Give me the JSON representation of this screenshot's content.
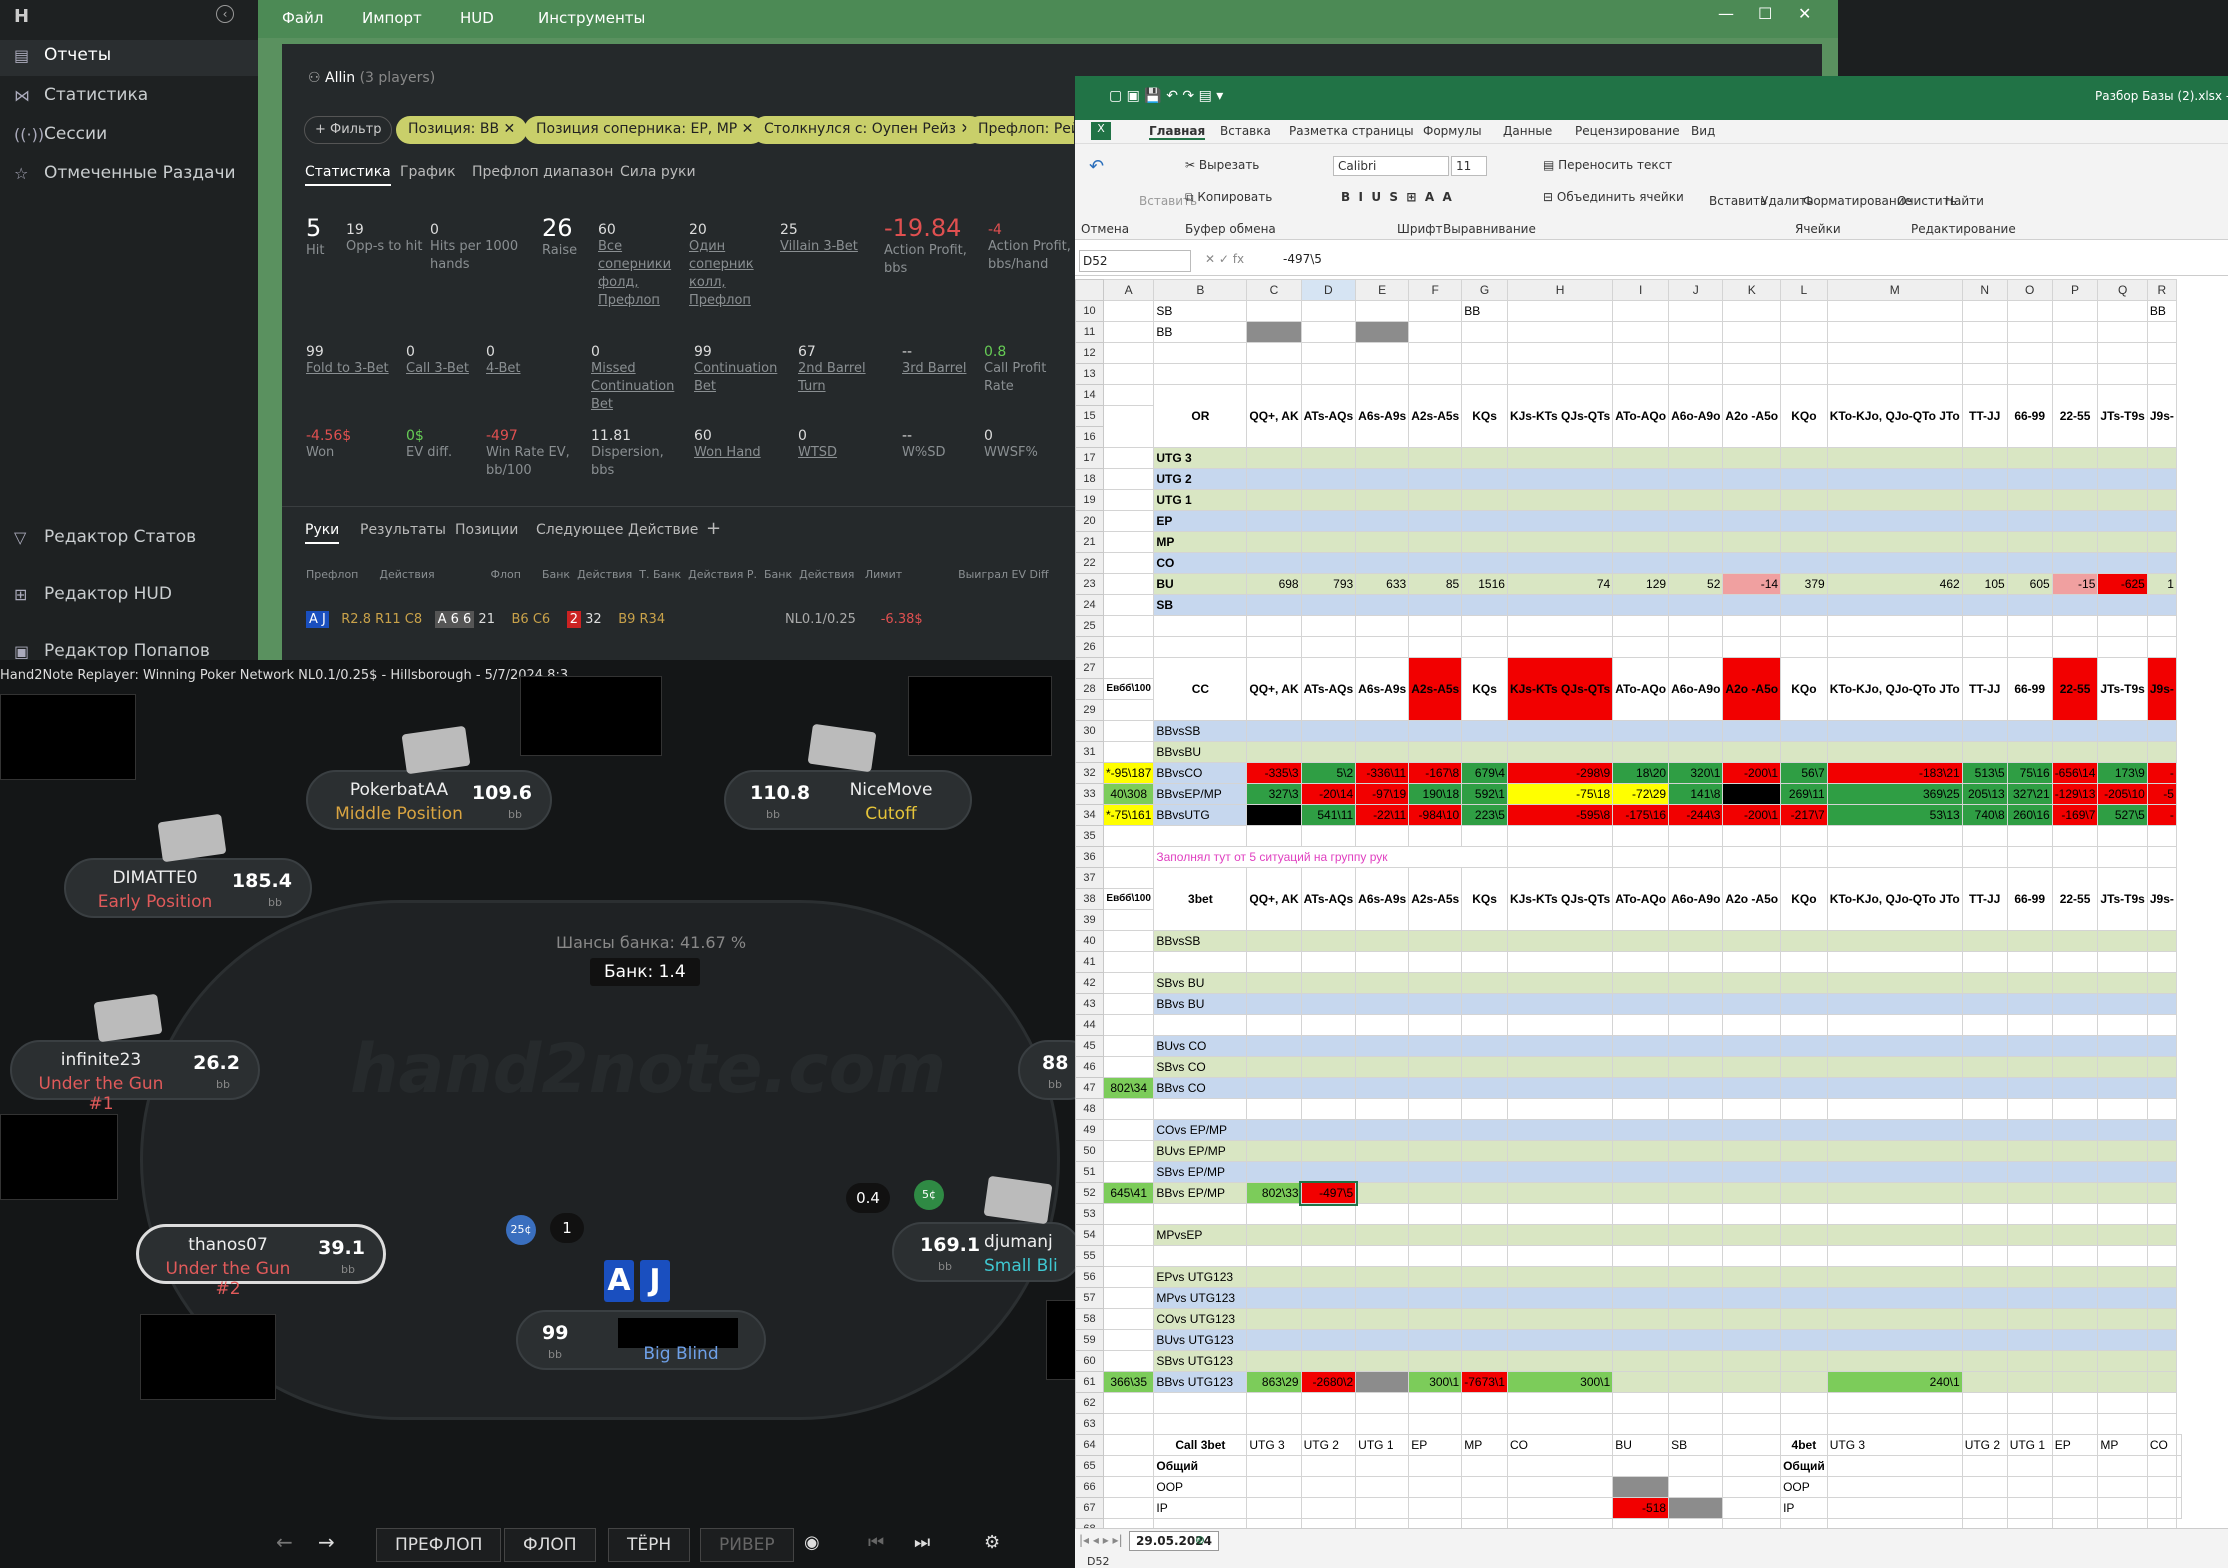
{
  "app": {
    "logo": "H",
    "menu": [
      "Файл",
      "Импорт",
      "HUD",
      "Инструменты"
    ]
  },
  "sidebar": {
    "items": [
      "Отчеты",
      "Статистика",
      "Сессии",
      "Отмеченные Раздачи"
    ],
    "tools": [
      "Редактор Статов",
      "Редактор HUD",
      "Редактор Попапов"
    ]
  },
  "report": {
    "title": "Allin",
    "subtitle": "(3 players)",
    "filter_btn": "+ Фильтр",
    "chips": [
      "Позиция: BB ✕",
      "Позиция соперника: EP, MP ✕",
      "Столкнулся с: Оупен Рейз ✕",
      "Префлоп: Рейз"
    ],
    "tabs": [
      "Статистика",
      "График",
      "Префлоп диапазон",
      "Сила руки"
    ],
    "stats_row1": [
      [
        "5",
        "Hit"
      ],
      [
        "19",
        "Opp-s to hit"
      ],
      [
        "0",
        "Hits per 1000 hands"
      ],
      [
        "26",
        "Raise"
      ],
      [
        "60",
        "Все соперники фолд, Префлоп"
      ],
      [
        "20",
        "Один соперник колл, Префлоп"
      ],
      [
        "25",
        "Villain 3-Bet"
      ],
      [
        "-19.84",
        "Action Profit, bbs"
      ],
      [
        "-4",
        "Action Profit, bbs/hand"
      ]
    ],
    "stats_row2": [
      [
        "99",
        "Fold to 3-Bet"
      ],
      [
        "0",
        "Call 3-Bet"
      ],
      [
        "0",
        "4-Bet"
      ],
      [
        "0",
        "Missed Continuation Bet"
      ],
      [
        "99",
        "Continuation Bet"
      ],
      [
        "67",
        "2nd Barrel Turn"
      ],
      [
        "--",
        "3rd Barrel"
      ],
      [
        "0.8",
        "Call Profit Rate"
      ]
    ],
    "stats_row3": [
      [
        "-4.56$",
        "Won"
      ],
      [
        "0$",
        "EV diff."
      ],
      [
        "-497",
        "Win Rate EV, bb/100"
      ],
      [
        "11.81",
        "Dispersion, bbs"
      ],
      [
        "60",
        "Won Hand"
      ],
      [
        "0",
        "WTSD"
      ],
      [
        "--",
        "W%SD"
      ],
      [
        "0",
        "WWSF%"
      ]
    ],
    "hand_tabs": [
      "Руки",
      "Результаты",
      "Позиции",
      "Следующее Действие",
      "+"
    ],
    "hand_cols": [
      "Префлоп",
      "Действия",
      "Флоп",
      "Банк",
      "Действия",
      "Т.",
      "Банк",
      "Действия",
      "Р.",
      "Банк",
      "Действия",
      "Лимит",
      "Выиграл",
      "EV Diff"
    ],
    "hand_row": {
      "cards": "A J",
      "pre": "R2.8 R11 C8",
      "flop": "A 6 6",
      "pot1": "21",
      "act2": "B6 C6",
      "turn": "2",
      "pot2": "32",
      "act3": "B9 R34",
      "limit": "NL0.1/0.25",
      "won": "-6.38$"
    }
  },
  "replayer": {
    "title": "Hand2Note Replayer: Winning Poker Network NL0.1/0.25$ - Hillsborough - 5/7/2024 8:3",
    "watermark": "hand2note.com",
    "pot_odds": "Шансы банка: 41.67 %",
    "pot": "Банк: 1.4",
    "seats": [
      {
        "name": "PokerbatAA",
        "pos": "Middle Position",
        "stack": "109.6",
        "unit": "bb"
      },
      {
        "name": "NiceMove",
        "pos": "Cutoff",
        "stack": "110.8",
        "unit": "bb"
      },
      {
        "name": "DIMATTE0",
        "pos": "Early Position",
        "stack": "185.4",
        "unit": "bb"
      },
      {
        "name": "infinite23",
        "pos": "Under the Gun #1",
        "stack": "26.2",
        "unit": "bb"
      },
      {
        "name": "thanos07",
        "pos": "Under the Gun #2",
        "stack": "39.1",
        "unit": "bb"
      },
      {
        "name": "djumanj",
        "pos": "Small Bli",
        "stack": "169.1",
        "unit": "bb"
      },
      {
        "name": "",
        "pos": "Big Blind",
        "stack": "99",
        "unit": "bb"
      },
      {
        "name": "",
        "pos": "",
        "stack": "88",
        "unit": "bb"
      }
    ],
    "bet_left": "1",
    "bet_right": "0.4",
    "chip_left": "25¢",
    "chip_right": "5¢",
    "hero_cards": [
      "A",
      "J"
    ],
    "controls": [
      "ПРЕФЛОП",
      "ФЛОП",
      "ТЁРН",
      "РИВЕР"
    ]
  },
  "excel": {
    "title": "Разбор Базы (2).xlsx - Ру",
    "tabs": [
      "Главная",
      "Вставка",
      "Разметка страницы",
      "Формулы",
      "Данные",
      "Рецензирование",
      "Вид"
    ],
    "ribbon": {
      "cut": "Вырезать",
      "copy": "Копировать",
      "paste": "Вставить",
      "font": "Calibri",
      "size": "11",
      "wrap": "Переносить текст",
      "merge": "Объединить ячейки",
      "insert": "Вставить",
      "delete": "Удалить",
      "format": "Форматирование",
      "clear": "Очистить",
      "find": "Найти",
      "undo": "Отмена",
      "clipboard": "Буфер обмена",
      "font_grp": "Шрифт",
      "align": "Выравнивание",
      "cells": "Ячейки",
      "edit": "Редактирование"
    },
    "namebox": "D52",
    "formula": "-497\\5",
    "sheet": "29.05.2024",
    "status_cell": "D52",
    "cols": [
      "A",
      "B",
      "C",
      "D",
      "E",
      "F",
      "G",
      "H",
      "I",
      "J",
      "K",
      "L",
      "M",
      "N",
      "O",
      "P",
      "Q",
      "R"
    ],
    "hands": [
      "QQ+, AK",
      "ATs-AQs",
      "A6s-A9s",
      "A2s-A5s",
      "KQs",
      "KJs-KTs QJs-QTs",
      "ATo-AQo",
      "A6o-A9o",
      "A2o -A5o",
      "KQo",
      "KTo-KJo, QJo-QTo JTo",
      "TT-JJ",
      "66-99",
      "22-55",
      "JTs-T9s",
      "J9s-"
    ],
    "note": "Заполнял тут от 5 ситуаций на группу рук",
    "or_label": "OR",
    "cc_label": "CC",
    "tb_label": "3bet",
    "ebb": "Евбб\\100",
    "or_rows": [
      "UTG 3",
      "UTG 2",
      "UTG 1",
      "EP",
      "MP",
      "CO",
      "BU",
      "SB"
    ],
    "bu_row": [
      "698",
      "793",
      "633",
      "85",
      "1516",
      "74",
      "129",
      "52",
      "-14",
      "379",
      "462",
      "105",
      "605",
      "-15",
      "-625",
      "1"
    ],
    "cc_rows": [
      "BBvsSB",
      "BBvsBU",
      "BBvsCO",
      "BBvsEP/MP",
      "BBvsUTG"
    ],
    "cc_a": [
      "*-95\\187",
      "40\\308",
      "*-75\\161"
    ],
    "co_row": [
      "-335\\3",
      "5\\2",
      "-336\\11",
      "-167\\8",
      "679\\4",
      "-298\\9",
      "18\\20",
      "320\\1",
      "-200\\1",
      "56\\7",
      "-183\\21",
      "513\\5",
      "75\\16",
      "-656\\14",
      "173\\9",
      "-"
    ],
    "epmp_row": [
      "327\\3",
      "-20\\14",
      "-97\\19",
      "190\\18",
      "592\\1",
      "-75\\18",
      "-72\\29",
      "141\\8",
      "",
      "269\\11",
      "369\\25",
      "205\\13",
      "327\\21",
      "-129\\13",
      "-205\\10",
      "-5"
    ],
    "utg_row": [
      "",
      "541\\11",
      "-22\\11",
      "-984\\10",
      "223\\5",
      "-595\\8",
      "-175\\16",
      "-244\\3",
      "-200\\1",
      "-217\\7",
      "53\\13",
      "740\\8",
      "260\\16",
      "-169\\7",
      "527\\5",
      "-"
    ],
    "tb_rows": [
      "BBvsSB",
      "",
      "SBvs BU",
      "BBvs BU",
      "",
      "BUvs CO",
      "SBvs CO",
      "BBvs CO",
      "",
      "COvs EP/MP",
      "BUvs EP/MP",
      "SBvs EP/MP",
      "BBvs EP/MP",
      "",
      "MPvsEP",
      "",
      "EPvs UTG123",
      "MPvs UTG123",
      "COvs UTG123",
      "BUvs UTG123",
      "SBvs UTG123",
      "BBvs UTG123"
    ],
    "a47": "802\\34",
    "a52": "645\\41",
    "c52": "802\\33",
    "d52": "-497\\5",
    "a61": "366\\35",
    "r61": [
      "863\\29",
      "-2680\\2",
      "",
      "300\\1",
      "-7673\\1",
      "300\\1",
      "",
      "",
      "",
      "",
      "240\\1"
    ],
    "call3": {
      "title": "Call 3bet",
      "cols": [
        "UTG 3",
        "UTG 2",
        "UTG 1",
        "EP",
        "MP",
        "CO",
        "BU",
        "SB"
      ],
      "rows": [
        "Общий",
        "OOP",
        "IP"
      ],
      "ip_bu": "-518"
    },
    "four": {
      "title": "4bet",
      "cols": [
        "UTG 3",
        "UTG 2",
        "UTG 1",
        "EP",
        "MP",
        "CO"
      ],
      "rows": [
        "Общий",
        "OOP",
        "IP"
      ]
    }
  }
}
